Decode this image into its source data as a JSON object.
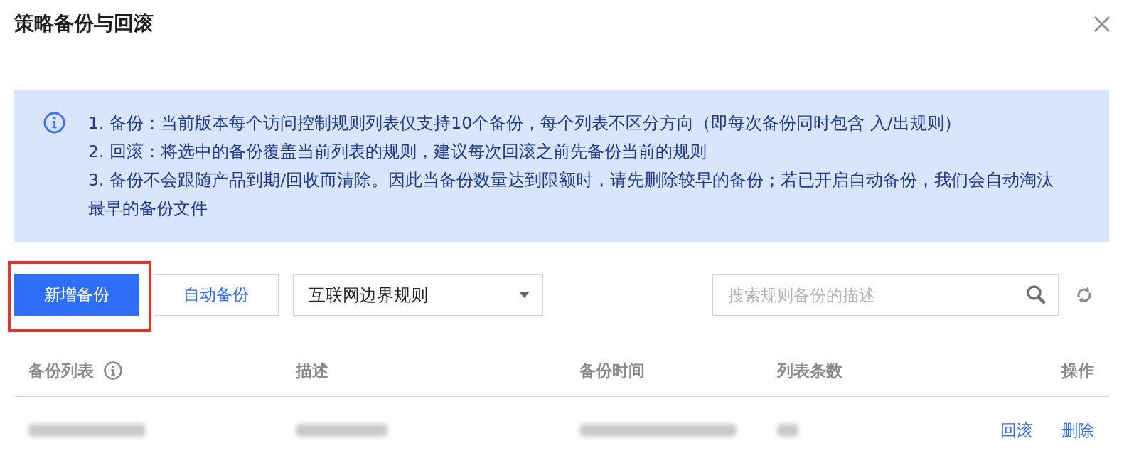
{
  "dialog": {
    "title": "策略备份与回滚"
  },
  "notice": {
    "items": [
      "1. 备份：当前版本每个访问控制规则列表仅支持10个备份，每个列表不区分方向（即每次备份同时包含 入/出规则）",
      "2. 回滚：将选中的备份覆盖当前列表的规则，建议每次回滚之前先备份当前的规则",
      "3. 备份不会跟随产品到期/回收而清除。因此当备份数量达到限额时，请先删除较早的备份；若已开启自动备份，我们会自动淘汰最早的备份文件"
    ]
  },
  "toolbar": {
    "buttons": [
      {
        "label": "新增备份",
        "kind": "primary",
        "highlighted": true
      },
      {
        "label": "自动备份",
        "kind": "secondary",
        "highlighted": false
      }
    ],
    "rule_list_select": {
      "value": "互联网边界规则"
    },
    "search": {
      "placeholder": "搜索规则备份的描述"
    }
  },
  "table": {
    "columns": [
      {
        "label": "备份列表",
        "hint_icon": true
      },
      {
        "label": "描述",
        "hint_icon": false
      },
      {
        "label": "备份时间",
        "hint_icon": false
      },
      {
        "label": "列表条数",
        "hint_icon": false
      },
      {
        "label": "操作",
        "hint_icon": false
      }
    ],
    "rows": [
      {
        "cells": [
          {
            "blurred": true
          },
          {
            "blurred": true
          },
          {
            "blurred": true
          },
          {
            "blurred": true
          }
        ],
        "actions": [
          "回滚",
          "删除"
        ]
      }
    ]
  }
}
